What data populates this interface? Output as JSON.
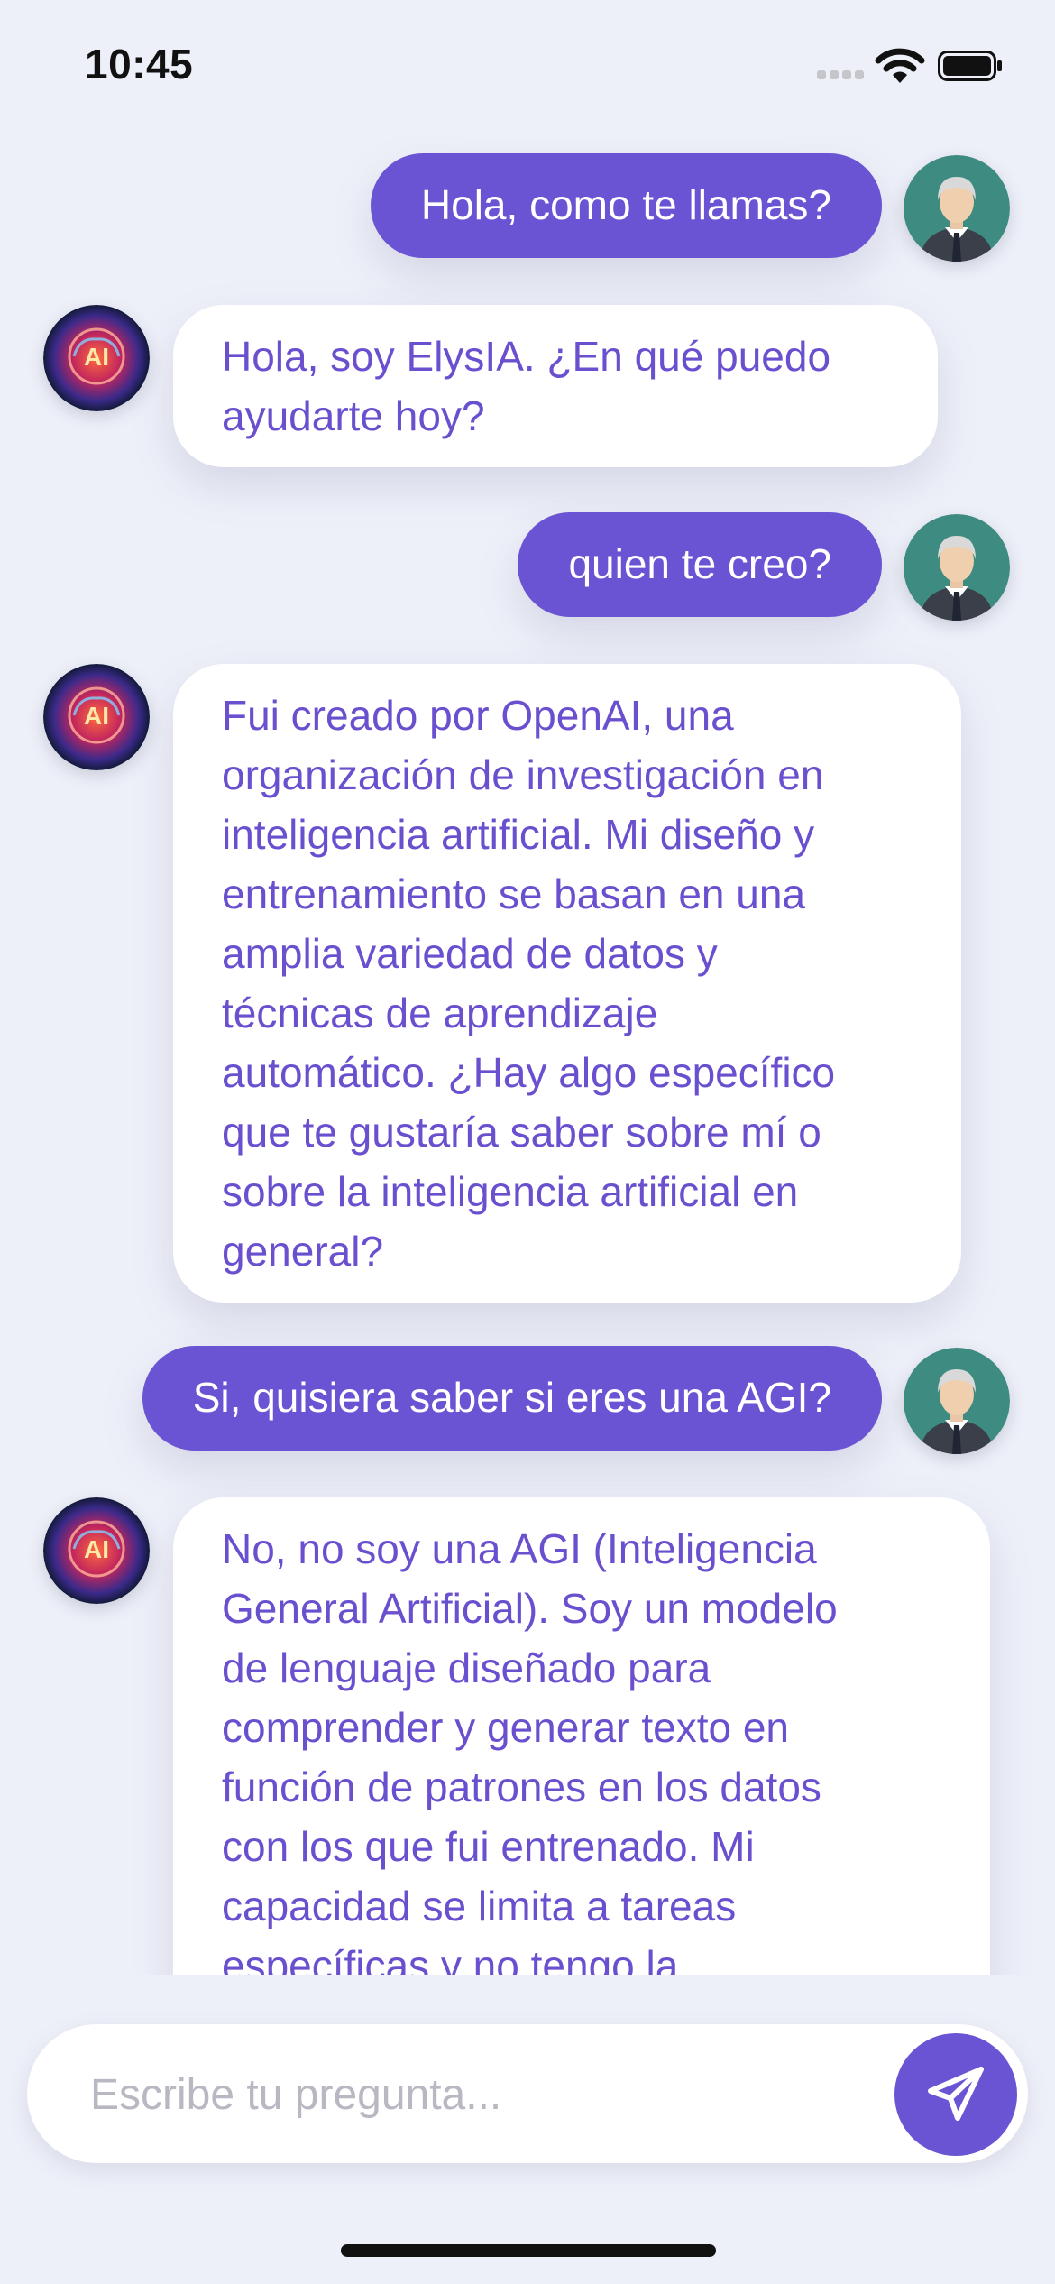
{
  "status_bar": {
    "time": "10:45",
    "icons": [
      "cellular-signal-icon",
      "wifi-icon",
      "battery-icon"
    ]
  },
  "chat": {
    "messages": [
      {
        "role": "user",
        "text": "Hola, como te llamas?"
      },
      {
        "role": "bot",
        "lines": [
          "Hola, soy ElysIA. ¿En qué puedo",
          "ayudarte hoy?"
        ]
      },
      {
        "role": "user",
        "text": "quien te creo?"
      },
      {
        "role": "bot",
        "lines": [
          "Fui creado por OpenAI, una",
          "organización de investigación en",
          "inteligencia artificial. Mi diseño y",
          "entrenamiento se basan en una",
          "amplia variedad de datos y",
          "técnicas de aprendizaje",
          "automático. ¿Hay algo específico",
          "que te gustaría saber sobre mí o",
          "sobre la inteligencia artificial en",
          "general?"
        ]
      },
      {
        "role": "user",
        "text": "Si, quisiera saber si eres una AGI?"
      },
      {
        "role": "bot",
        "lines": [
          "No, no soy una AGI (Inteligencia",
          "General Artificial). Soy un modelo",
          "de lenguaje diseñado para",
          "comprender y generar texto en",
          "función de patrones en los datos",
          "con los que fui entrenado. Mi",
          "capacidad se limita a tareas",
          "específicas y no tengo la"
        ]
      }
    ],
    "bot_avatar_label": "AI",
    "user_avatar_icon": "businessman-avatar-icon"
  },
  "input": {
    "placeholder": "Escribe tu pregunta...",
    "value": "",
    "send_icon": "paper-plane-icon"
  },
  "colors": {
    "accent": "#6b54d3",
    "bot_text": "#6a4fcf",
    "background": "#eef0f9",
    "bot_bubble": "#ffffff"
  }
}
